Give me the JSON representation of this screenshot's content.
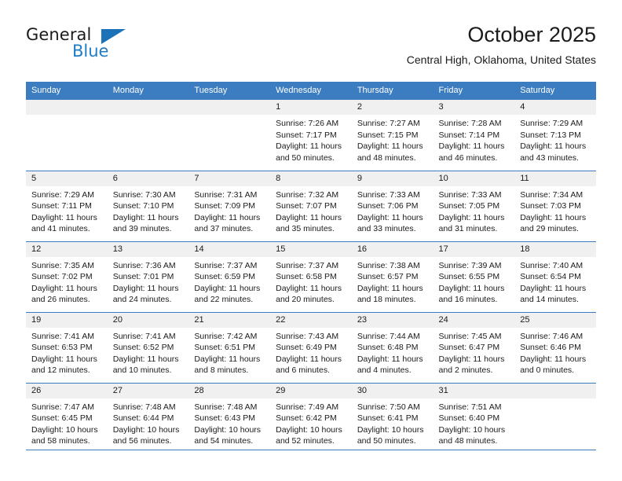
{
  "brand": {
    "word_general": "General",
    "word_blue": "Blue",
    "flag_icon": "triangle-flag-icon"
  },
  "header": {
    "title": "October 2025",
    "subtitle": "Central High, Oklahoma, United States"
  },
  "colors": {
    "header_blue": "#3b7dc0",
    "daynum_band": "#f0f0f0",
    "brand_blue": "#1f7cc4",
    "text": "#1b1b1b"
  },
  "weekday_headers": [
    "Sunday",
    "Monday",
    "Tuesday",
    "Wednesday",
    "Thursday",
    "Friday",
    "Saturday"
  ],
  "weeks": [
    [
      {
        "day": "",
        "empty": true,
        "sunrise": "",
        "sunset": "",
        "daylight_1": "",
        "daylight_2": ""
      },
      {
        "day": "",
        "empty": true,
        "sunrise": "",
        "sunset": "",
        "daylight_1": "",
        "daylight_2": ""
      },
      {
        "day": "",
        "empty": true,
        "sunrise": "",
        "sunset": "",
        "daylight_1": "",
        "daylight_2": ""
      },
      {
        "day": "1",
        "empty": false,
        "sunrise": "Sunrise: 7:26 AM",
        "sunset": "Sunset: 7:17 PM",
        "daylight_1": "Daylight: 11 hours",
        "daylight_2": "and 50 minutes."
      },
      {
        "day": "2",
        "empty": false,
        "sunrise": "Sunrise: 7:27 AM",
        "sunset": "Sunset: 7:15 PM",
        "daylight_1": "Daylight: 11 hours",
        "daylight_2": "and 48 minutes."
      },
      {
        "day": "3",
        "empty": false,
        "sunrise": "Sunrise: 7:28 AM",
        "sunset": "Sunset: 7:14 PM",
        "daylight_1": "Daylight: 11 hours",
        "daylight_2": "and 46 minutes."
      },
      {
        "day": "4",
        "empty": false,
        "sunrise": "Sunrise: 7:29 AM",
        "sunset": "Sunset: 7:13 PM",
        "daylight_1": "Daylight: 11 hours",
        "daylight_2": "and 43 minutes."
      }
    ],
    [
      {
        "day": "5",
        "empty": false,
        "sunrise": "Sunrise: 7:29 AM",
        "sunset": "Sunset: 7:11 PM",
        "daylight_1": "Daylight: 11 hours",
        "daylight_2": "and 41 minutes."
      },
      {
        "day": "6",
        "empty": false,
        "sunrise": "Sunrise: 7:30 AM",
        "sunset": "Sunset: 7:10 PM",
        "daylight_1": "Daylight: 11 hours",
        "daylight_2": "and 39 minutes."
      },
      {
        "day": "7",
        "empty": false,
        "sunrise": "Sunrise: 7:31 AM",
        "sunset": "Sunset: 7:09 PM",
        "daylight_1": "Daylight: 11 hours",
        "daylight_2": "and 37 minutes."
      },
      {
        "day": "8",
        "empty": false,
        "sunrise": "Sunrise: 7:32 AM",
        "sunset": "Sunset: 7:07 PM",
        "daylight_1": "Daylight: 11 hours",
        "daylight_2": "and 35 minutes."
      },
      {
        "day": "9",
        "empty": false,
        "sunrise": "Sunrise: 7:33 AM",
        "sunset": "Sunset: 7:06 PM",
        "daylight_1": "Daylight: 11 hours",
        "daylight_2": "and 33 minutes."
      },
      {
        "day": "10",
        "empty": false,
        "sunrise": "Sunrise: 7:33 AM",
        "sunset": "Sunset: 7:05 PM",
        "daylight_1": "Daylight: 11 hours",
        "daylight_2": "and 31 minutes."
      },
      {
        "day": "11",
        "empty": false,
        "sunrise": "Sunrise: 7:34 AM",
        "sunset": "Sunset: 7:03 PM",
        "daylight_1": "Daylight: 11 hours",
        "daylight_2": "and 29 minutes."
      }
    ],
    [
      {
        "day": "12",
        "empty": false,
        "sunrise": "Sunrise: 7:35 AM",
        "sunset": "Sunset: 7:02 PM",
        "daylight_1": "Daylight: 11 hours",
        "daylight_2": "and 26 minutes."
      },
      {
        "day": "13",
        "empty": false,
        "sunrise": "Sunrise: 7:36 AM",
        "sunset": "Sunset: 7:01 PM",
        "daylight_1": "Daylight: 11 hours",
        "daylight_2": "and 24 minutes."
      },
      {
        "day": "14",
        "empty": false,
        "sunrise": "Sunrise: 7:37 AM",
        "sunset": "Sunset: 6:59 PM",
        "daylight_1": "Daylight: 11 hours",
        "daylight_2": "and 22 minutes."
      },
      {
        "day": "15",
        "empty": false,
        "sunrise": "Sunrise: 7:37 AM",
        "sunset": "Sunset: 6:58 PM",
        "daylight_1": "Daylight: 11 hours",
        "daylight_2": "and 20 minutes."
      },
      {
        "day": "16",
        "empty": false,
        "sunrise": "Sunrise: 7:38 AM",
        "sunset": "Sunset: 6:57 PM",
        "daylight_1": "Daylight: 11 hours",
        "daylight_2": "and 18 minutes."
      },
      {
        "day": "17",
        "empty": false,
        "sunrise": "Sunrise: 7:39 AM",
        "sunset": "Sunset: 6:55 PM",
        "daylight_1": "Daylight: 11 hours",
        "daylight_2": "and 16 minutes."
      },
      {
        "day": "18",
        "empty": false,
        "sunrise": "Sunrise: 7:40 AM",
        "sunset": "Sunset: 6:54 PM",
        "daylight_1": "Daylight: 11 hours",
        "daylight_2": "and 14 minutes."
      }
    ],
    [
      {
        "day": "19",
        "empty": false,
        "sunrise": "Sunrise: 7:41 AM",
        "sunset": "Sunset: 6:53 PM",
        "daylight_1": "Daylight: 11 hours",
        "daylight_2": "and 12 minutes."
      },
      {
        "day": "20",
        "empty": false,
        "sunrise": "Sunrise: 7:41 AM",
        "sunset": "Sunset: 6:52 PM",
        "daylight_1": "Daylight: 11 hours",
        "daylight_2": "and 10 minutes."
      },
      {
        "day": "21",
        "empty": false,
        "sunrise": "Sunrise: 7:42 AM",
        "sunset": "Sunset: 6:51 PM",
        "daylight_1": "Daylight: 11 hours",
        "daylight_2": "and 8 minutes."
      },
      {
        "day": "22",
        "empty": false,
        "sunrise": "Sunrise: 7:43 AM",
        "sunset": "Sunset: 6:49 PM",
        "daylight_1": "Daylight: 11 hours",
        "daylight_2": "and 6 minutes."
      },
      {
        "day": "23",
        "empty": false,
        "sunrise": "Sunrise: 7:44 AM",
        "sunset": "Sunset: 6:48 PM",
        "daylight_1": "Daylight: 11 hours",
        "daylight_2": "and 4 minutes."
      },
      {
        "day": "24",
        "empty": false,
        "sunrise": "Sunrise: 7:45 AM",
        "sunset": "Sunset: 6:47 PM",
        "daylight_1": "Daylight: 11 hours",
        "daylight_2": "and 2 minutes."
      },
      {
        "day": "25",
        "empty": false,
        "sunrise": "Sunrise: 7:46 AM",
        "sunset": "Sunset: 6:46 PM",
        "daylight_1": "Daylight: 11 hours",
        "daylight_2": "and 0 minutes."
      }
    ],
    [
      {
        "day": "26",
        "empty": false,
        "sunrise": "Sunrise: 7:47 AM",
        "sunset": "Sunset: 6:45 PM",
        "daylight_1": "Daylight: 10 hours",
        "daylight_2": "and 58 minutes."
      },
      {
        "day": "27",
        "empty": false,
        "sunrise": "Sunrise: 7:48 AM",
        "sunset": "Sunset: 6:44 PM",
        "daylight_1": "Daylight: 10 hours",
        "daylight_2": "and 56 minutes."
      },
      {
        "day": "28",
        "empty": false,
        "sunrise": "Sunrise: 7:48 AM",
        "sunset": "Sunset: 6:43 PM",
        "daylight_1": "Daylight: 10 hours",
        "daylight_2": "and 54 minutes."
      },
      {
        "day": "29",
        "empty": false,
        "sunrise": "Sunrise: 7:49 AM",
        "sunset": "Sunset: 6:42 PM",
        "daylight_1": "Daylight: 10 hours",
        "daylight_2": "and 52 minutes."
      },
      {
        "day": "30",
        "empty": false,
        "sunrise": "Sunrise: 7:50 AM",
        "sunset": "Sunset: 6:41 PM",
        "daylight_1": "Daylight: 10 hours",
        "daylight_2": "and 50 minutes."
      },
      {
        "day": "31",
        "empty": false,
        "sunrise": "Sunrise: 7:51 AM",
        "sunset": "Sunset: 6:40 PM",
        "daylight_1": "Daylight: 10 hours",
        "daylight_2": "and 48 minutes."
      },
      {
        "day": "",
        "empty": true,
        "sunrise": "",
        "sunset": "",
        "daylight_1": "",
        "daylight_2": ""
      }
    ]
  ]
}
